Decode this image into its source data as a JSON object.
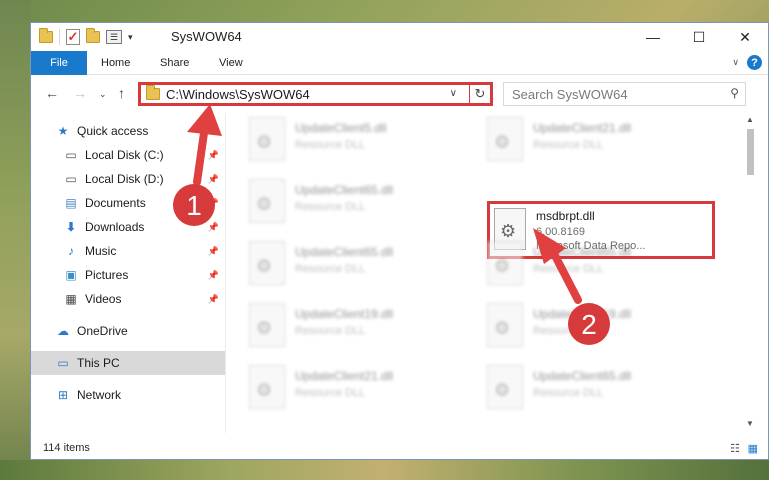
{
  "window": {
    "title": "SysWOW64"
  },
  "ribbon": {
    "tabs": [
      "File",
      "Home",
      "Share",
      "View"
    ],
    "help": "?"
  },
  "address": {
    "path": "C:\\Windows\\SysWOW64"
  },
  "search": {
    "placeholder": "Search SysWOW64"
  },
  "sidebar": {
    "items": [
      {
        "label": "Quick access",
        "icon": "star-icon"
      },
      {
        "label": "Local Disk (C:)",
        "icon": "drive-icon"
      },
      {
        "label": "Local Disk (D:)",
        "icon": "drive-icon"
      },
      {
        "label": "Documents",
        "icon": "documents-icon"
      },
      {
        "label": "Downloads",
        "icon": "download-arrow-icon"
      },
      {
        "label": "Music",
        "icon": "music-note-icon"
      },
      {
        "label": "Pictures",
        "icon": "pictures-icon"
      },
      {
        "label": "Videos",
        "icon": "videos-icon"
      },
      {
        "label": "OneDrive",
        "icon": "cloud-icon"
      },
      {
        "label": "This PC",
        "icon": "monitor-icon"
      },
      {
        "label": "Network",
        "icon": "network-icon"
      }
    ]
  },
  "files": [
    {
      "name": "UpdateClient5.dll",
      "desc": "Resource DLL"
    },
    {
      "name": "UpdateClient21.dll",
      "desc": "Resource DLL"
    },
    {
      "name": "UpdateClient65.dll",
      "desc": "Resource DLL"
    },
    {
      "name": "UpdateClient65.dll",
      "desc": "Resource DLL"
    },
    {
      "name": "UpdateClient65.dll",
      "desc": "Resource DLL"
    },
    {
      "name": "UpdateClient19.dll",
      "desc": "Resource DLL"
    },
    {
      "name": "UpdateClient19.dll",
      "desc": "Resource DLL"
    },
    {
      "name": "UpdateClient21.dll",
      "desc": "Resource DLL"
    },
    {
      "name": "UpdateClient65.dll",
      "desc": "Resource DLL"
    }
  ],
  "featured_file": {
    "name": "msdbrpt.dll",
    "version": "6.00.8169",
    "desc": "Microsoft Data Repo..."
  },
  "status": {
    "item_count": "114 items"
  },
  "annotations": {
    "step1": "1",
    "step2": "2"
  },
  "colors": {
    "highlight": "#d8393c",
    "accent": "#1979ca"
  }
}
